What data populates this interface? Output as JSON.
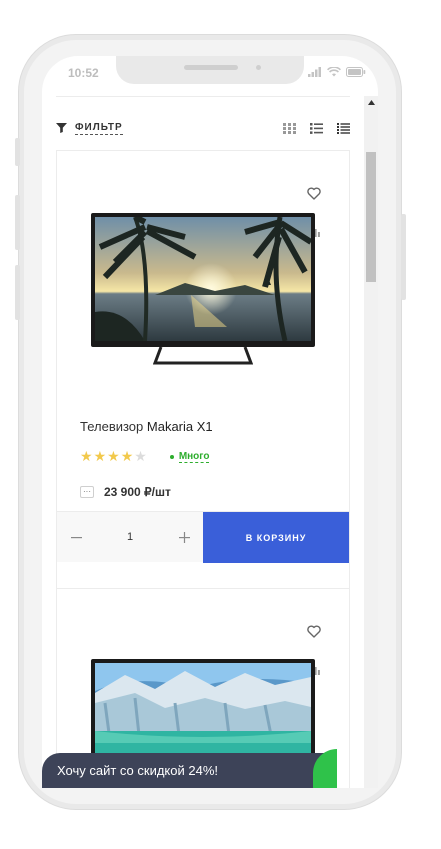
{
  "status_bar": {
    "time": "10:52"
  },
  "toolbar": {
    "filter_label": "ФИЛЬТР"
  },
  "products": [
    {
      "title_prefix": "Телевизор ",
      "title_brand": "Makaria X1",
      "rating": 4,
      "rating_max": 5,
      "stock_label": "Много",
      "price_badge": "···",
      "price": "23 900 ₽/шт",
      "quantity": "1",
      "cart_label": "В КОРЗИНУ"
    },
    {}
  ],
  "promo": {
    "text": "Хочу сайт со скидкой 24%!"
  },
  "colors": {
    "accent": "#3a5fd9",
    "stock": "#2dad2d",
    "promo_bg": "#3d4358",
    "promo_accent": "#2fc24a",
    "star": "#f2c94c"
  },
  "icons": [
    "filter-icon",
    "grid-view-icon",
    "list-view-icon",
    "table-view-icon",
    "heart-icon",
    "compare-icon",
    "minus-icon",
    "plus-icon"
  ]
}
